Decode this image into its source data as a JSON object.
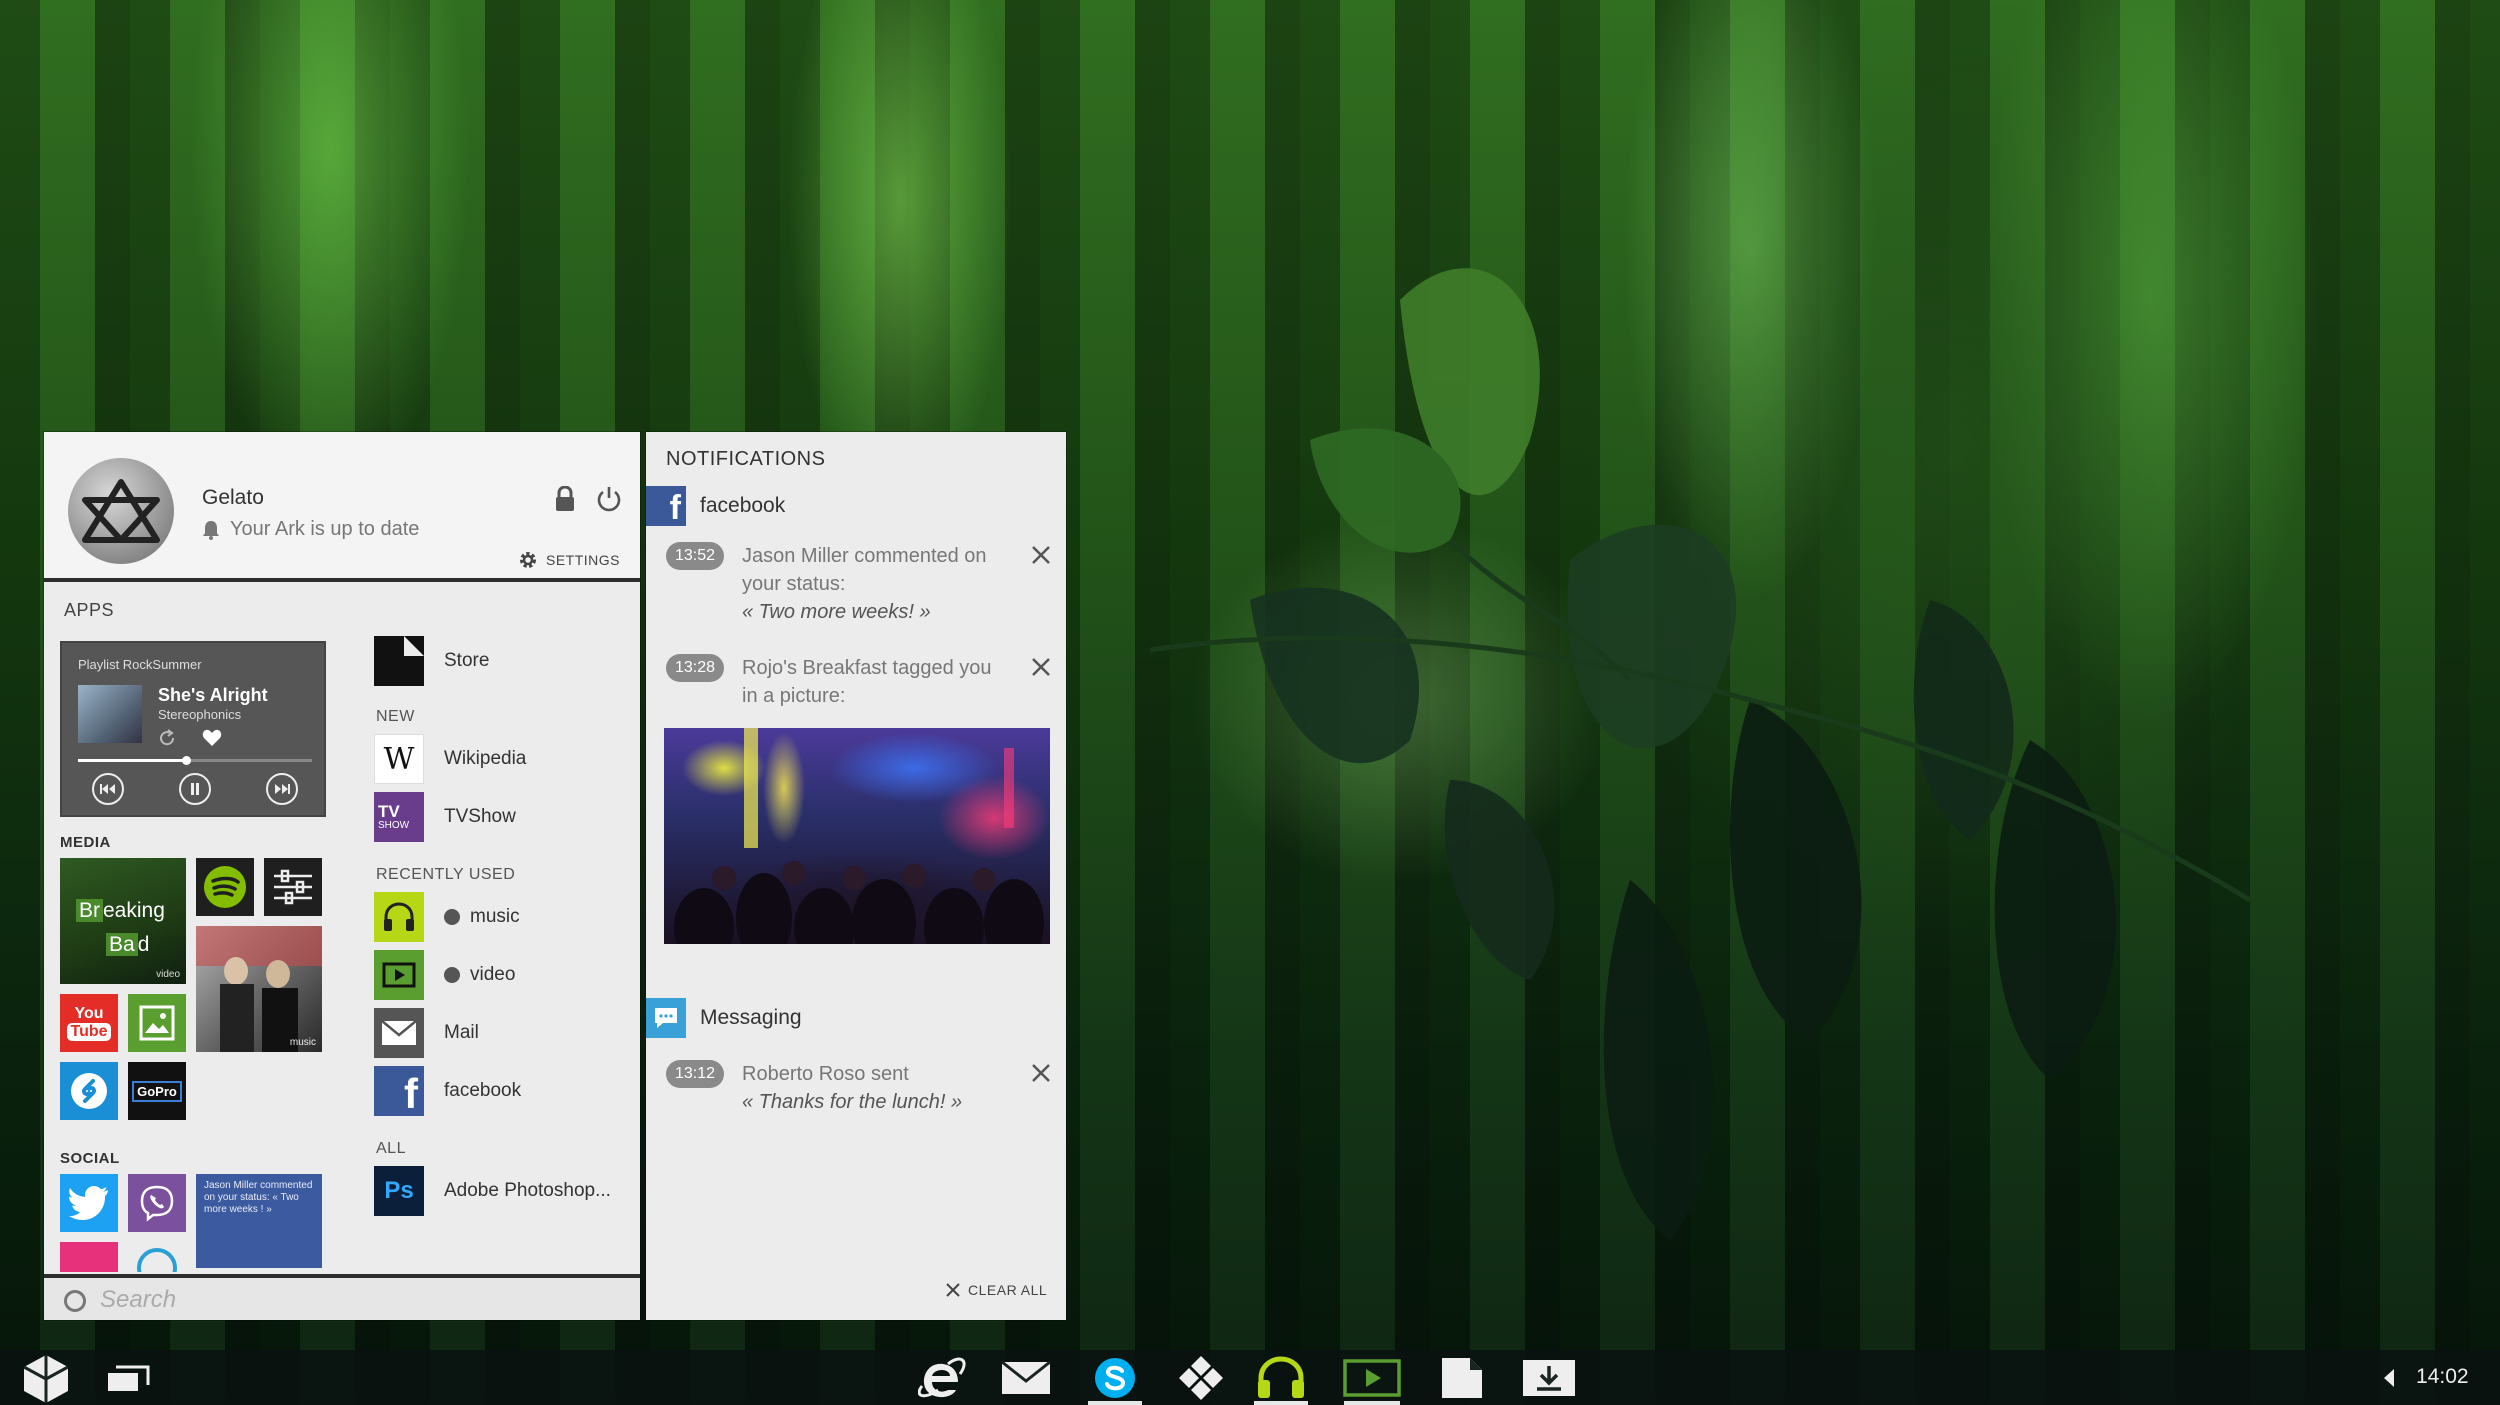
{
  "profile": {
    "name": "Gelato",
    "status": "Your Ark is up to date",
    "settings_label": "SETTINGS"
  },
  "apps": {
    "title": "APPS",
    "music_widget": {
      "playlist": "Playlist RockSummer",
      "song": "She's Alright",
      "artist": "Stereophonics",
      "progress": 0.46
    },
    "media_title": "MEDIA",
    "social_title": "SOCIAL",
    "tiles": {
      "breaking_bad": [
        "Br",
        "eaking",
        "Ba",
        "d"
      ],
      "breaking_bad_badge": "video",
      "album_badge": "music",
      "youtube": [
        "You",
        "Tube"
      ],
      "gopro": "GoPro",
      "social_notif": "Jason Miller commented on your status: « Two more weeks ! »"
    },
    "store_label": "Store",
    "new_title": "NEW",
    "new_items": [
      {
        "label": "Wikipedia",
        "icon": "wikipedia-icon"
      },
      {
        "label": "TVShow",
        "icon": "tvshow-icon",
        "icon_text": "TV",
        "icon_subtext": "SHOW"
      }
    ],
    "recent_title": "RECENTLY USED",
    "recent_items": [
      {
        "label": "music",
        "icon": "headphones-icon"
      },
      {
        "label": "video",
        "icon": "video-icon"
      },
      {
        "label": "Mail",
        "icon": "mail-icon"
      },
      {
        "label": "facebook",
        "icon": "facebook-icon"
      }
    ],
    "all_title": "ALL",
    "all_items": [
      {
        "label": "Adobe Photoshop...",
        "icon": "photoshop-icon",
        "icon_text": "Ps"
      }
    ]
  },
  "search": {
    "placeholder": "Search"
  },
  "notifications": {
    "title": "NOTIFICATIONS",
    "clear_all": "CLEAR ALL",
    "groups": [
      {
        "app": "facebook",
        "items": [
          {
            "time": "13:52",
            "text": "Jason Miller commented on your status:",
            "quote": "« Two more weeks! »"
          },
          {
            "time": "13:28",
            "text": "Rojo's Breakfast tagged you in a picture:",
            "quote": ""
          }
        ]
      },
      {
        "app": "Messaging",
        "items": [
          {
            "time": "13:12",
            "text": "Roberto Roso sent",
            "quote": "« Thanks for the lunch! »"
          }
        ]
      }
    ]
  },
  "taskbar": {
    "time": "14:02",
    "icons": [
      "start-logo-icon",
      "task-view-icon",
      "internet-explorer-icon",
      "mail-icon",
      "skype-icon",
      "games-icon",
      "headphones-icon",
      "video-icon",
      "store-icon",
      "download-icon"
    ]
  },
  "colors": {
    "facebook": "#3b5998",
    "twitter": "#1da1f2",
    "viber": "#7b519d",
    "youtube": "#e52d27",
    "lime": "#b6d716",
    "green_tile": "#5a9e2f",
    "skype": "#00aff0",
    "accent": "#8bc34a"
  }
}
